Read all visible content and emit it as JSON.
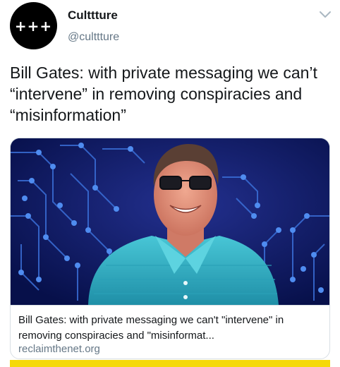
{
  "account": {
    "display_name": "Culttture",
    "handle": "@culttture",
    "avatar_text": "+++"
  },
  "tweet": {
    "text": "Bill Gates: with private messaging we can’t “intervene” in removing conspiracies and “misinformation”"
  },
  "card": {
    "title": "Bill Gates: with private messaging we can't \"intervene\" in removing conspiracies and \"misinformat...",
    "domain": "reclaimthenet.org"
  },
  "icons": {
    "menu": "chevron-down-icon"
  },
  "colors": {
    "accent_bar": "#f5d90a",
    "image_background": "#0b1560",
    "shirt": "#3bb7c9"
  }
}
